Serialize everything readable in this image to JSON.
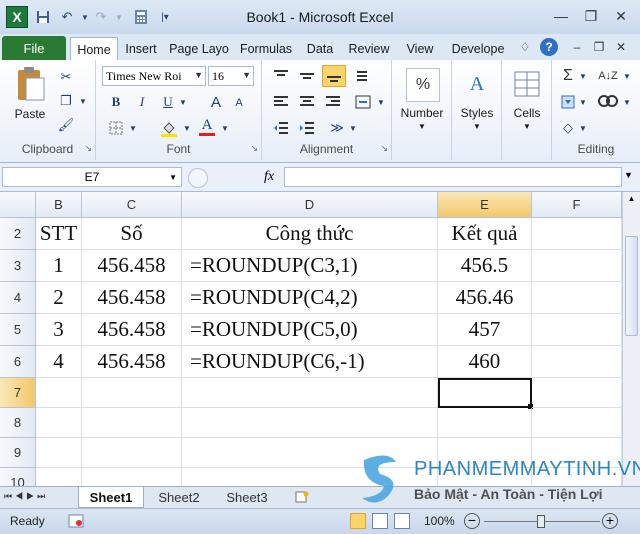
{
  "window": {
    "title": "Book1 - Microsoft Excel"
  },
  "ribbon_tabs": [
    {
      "label": "File"
    },
    {
      "label": "Home"
    },
    {
      "label": "Insert"
    },
    {
      "label": "Page Layo"
    },
    {
      "label": "Formulas"
    },
    {
      "label": "Data"
    },
    {
      "label": "Review"
    },
    {
      "label": "View"
    },
    {
      "label": "Develope"
    }
  ],
  "ribbon": {
    "clipboard": {
      "label": "Clipboard",
      "paste": "Paste"
    },
    "font": {
      "label": "Font",
      "font_name": "Times New Roi",
      "font_size": "16",
      "bold": "B",
      "italic": "I",
      "underline": "U",
      "grow": "A",
      "shrink": "A",
      "color": "A"
    },
    "alignment": {
      "label": "Alignment"
    },
    "number": {
      "label": "Number",
      "symbol": "%"
    },
    "styles": {
      "label": "Styles",
      "symbol": "A"
    },
    "cells": {
      "label": "Cells"
    },
    "editing": {
      "label": "Editing",
      "sum": "Σ"
    }
  },
  "formula_bar": {
    "name_box": "E7",
    "fx": "fx",
    "value": ""
  },
  "columns": [
    "B",
    "C",
    "D",
    "E",
    "F"
  ],
  "rows": [
    {
      "num": "2",
      "cells": [
        "STT",
        "Số",
        "Công thức",
        "Kết quả",
        ""
      ]
    },
    {
      "num": "3",
      "cells": [
        "1",
        "456.458",
        "=ROUNDUP(C3,1)",
        "456.5",
        ""
      ]
    },
    {
      "num": "4",
      "cells": [
        "2",
        "456.458",
        "=ROUNDUP(C4,2)",
        "456.46",
        ""
      ]
    },
    {
      "num": "5",
      "cells": [
        "3",
        "456.458",
        "=ROUNDUP(C5,0)",
        "457",
        ""
      ]
    },
    {
      "num": "6",
      "cells": [
        "4",
        "456.458",
        "=ROUNDUP(C6,-1)",
        "460",
        ""
      ]
    },
    {
      "num": "7",
      "cells": [
        "",
        "",
        "",
        "",
        ""
      ]
    },
    {
      "num": "8",
      "cells": [
        "",
        "",
        "",
        "",
        ""
      ]
    },
    {
      "num": "9",
      "cells": [
        "",
        "",
        "",
        "",
        ""
      ]
    },
    {
      "num": "10",
      "cells": [
        "",
        "",
        "",
        "",
        ""
      ]
    }
  ],
  "sheets": [
    "Sheet1",
    "Sheet2",
    "Sheet3"
  ],
  "status": {
    "ready": "Ready",
    "zoom": "100%"
  },
  "watermark": {
    "brand": "PHANMEMMAYTINH.VN",
    "tagline": "Bảo Mật - An Toàn - Tiện Lợi"
  },
  "colors": {
    "file_tab": "#2a7a33",
    "selected_header": "#f4c86a",
    "accent": "#1f3f6e"
  }
}
